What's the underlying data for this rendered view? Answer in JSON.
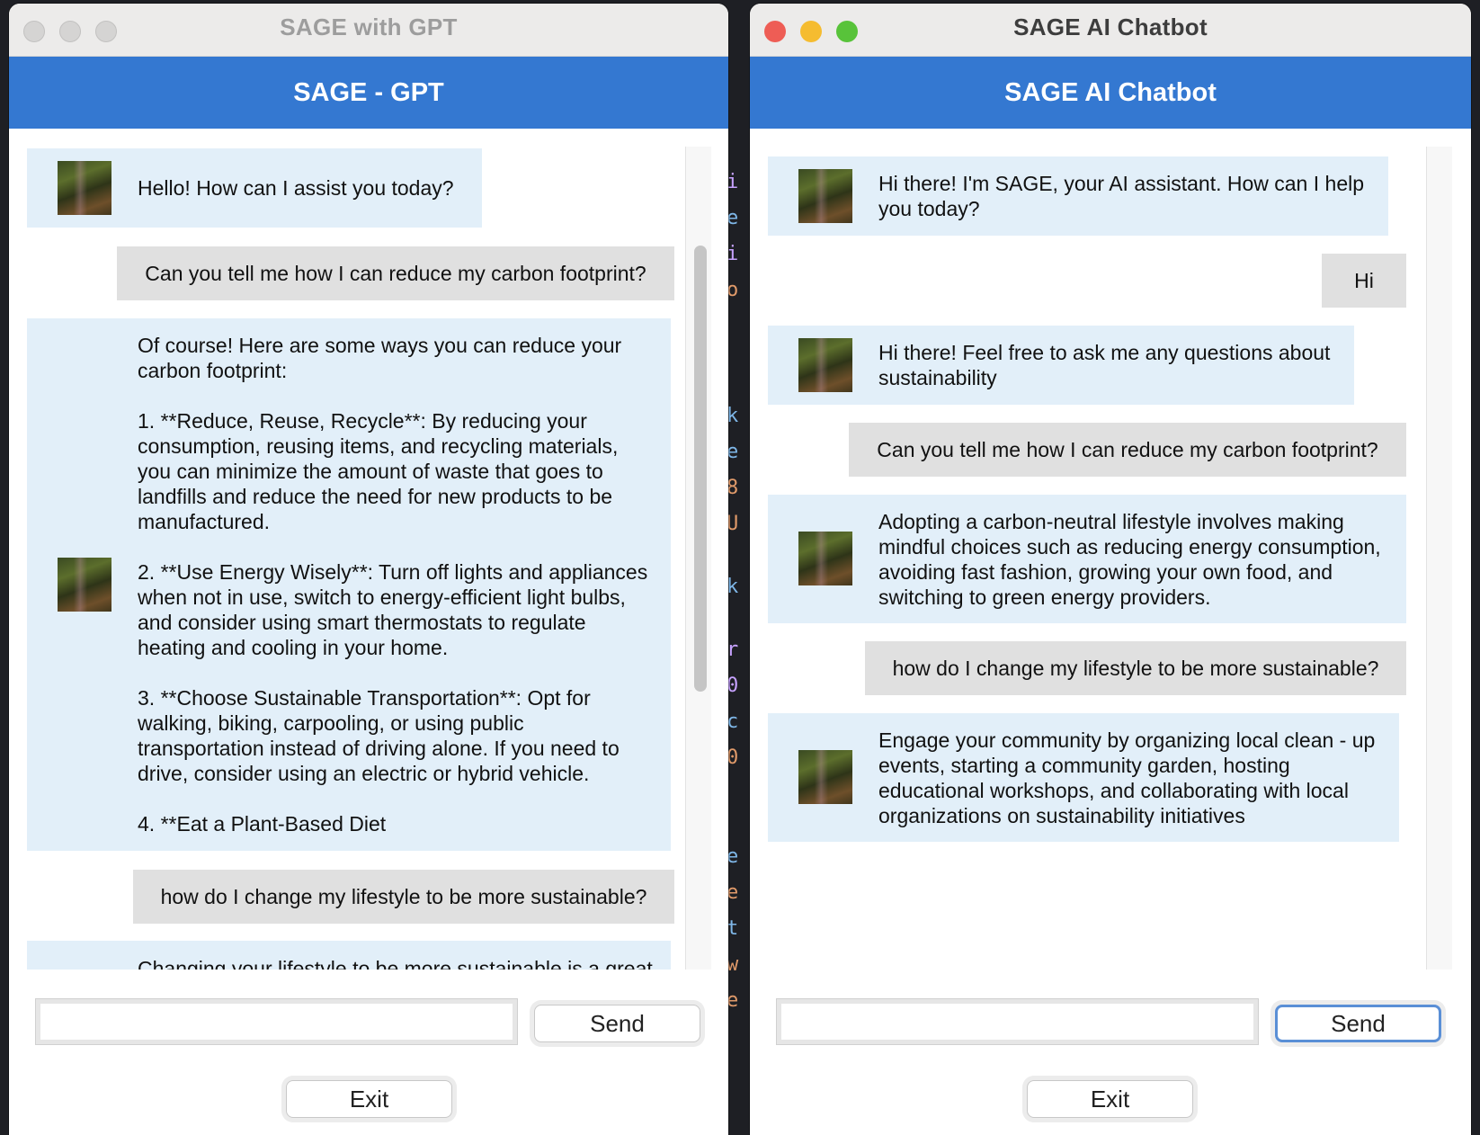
{
  "windows": {
    "gpt": {
      "window_title": "SAGE with GPT",
      "header": "SAGE - GPT",
      "messages": [
        {
          "role": "bot",
          "text": "Hello! How can I assist you today?"
        },
        {
          "role": "user",
          "text": "Can you tell me how I can reduce my carbon footprint?"
        },
        {
          "role": "bot",
          "text": "Of course! Here are some ways you can reduce your\ncarbon footprint:\n\n1. **Reduce, Reuse, Recycle**: By reducing your\nconsumption, reusing items, and recycling materials,\nyou can minimize the amount of waste that goes to\nlandfills and reduce the need for new products to be\nmanufactured.\n\n2. **Use Energy Wisely**: Turn off lights and appliances\nwhen not in use, switch to energy-efficient light bulbs,\nand consider using smart thermostats to regulate\nheating and cooling in your home.\n\n3. **Choose Sustainable Transportation**: Opt for\nwalking, biking, carpooling, or using public\ntransportation instead of driving alone. If you need to\ndrive, consider using an electric or hybrid vehicle.\n\n4. **Eat a Plant-Based Diet"
        },
        {
          "role": "user",
          "text": "how do I change my lifestyle to be more sustainable?"
        },
        {
          "role": "bot",
          "text": "Changing your lifestyle to be more sustainable is a great"
        }
      ],
      "input_value": "",
      "send_label": "Send",
      "exit_label": "Exit"
    },
    "chatbot": {
      "window_title": "SAGE AI Chatbot",
      "header": "SAGE AI Chatbot",
      "messages": [
        {
          "role": "bot",
          "text": "Hi there! I'm SAGE, your AI assistant. How can I help\nyou today?"
        },
        {
          "role": "user",
          "text": "Hi"
        },
        {
          "role": "bot",
          "text": "Hi there! Feel free to ask me any questions about\nsustainability"
        },
        {
          "role": "user",
          "text": "Can you tell me how I can reduce my carbon footprint?"
        },
        {
          "role": "bot",
          "text": "Adopting a carbon-neutral lifestyle involves making\nmindful choices such as reducing energy consumption,\navoiding fast fashion, growing your own food, and\nswitching to green energy providers."
        },
        {
          "role": "user",
          "text": "how do I change my lifestyle to be more sustainable?"
        },
        {
          "role": "bot",
          "text": "Engage your community by organizing local clean - up\nevents, starting a community garden, hosting\neducational workshops, and collaborating with local\norganizations on sustainability initiatives"
        }
      ],
      "input_value": "",
      "send_label": "Send",
      "exit_label": "Exit"
    }
  },
  "colors": {
    "header_blue": "#3478d1",
    "bot_bubble": "#e2eff9",
    "user_bubble": "#e0e0e0",
    "traffic_close": "#ee5d55",
    "traffic_min": "#f5bc30",
    "traffic_max": "#58c33a"
  }
}
